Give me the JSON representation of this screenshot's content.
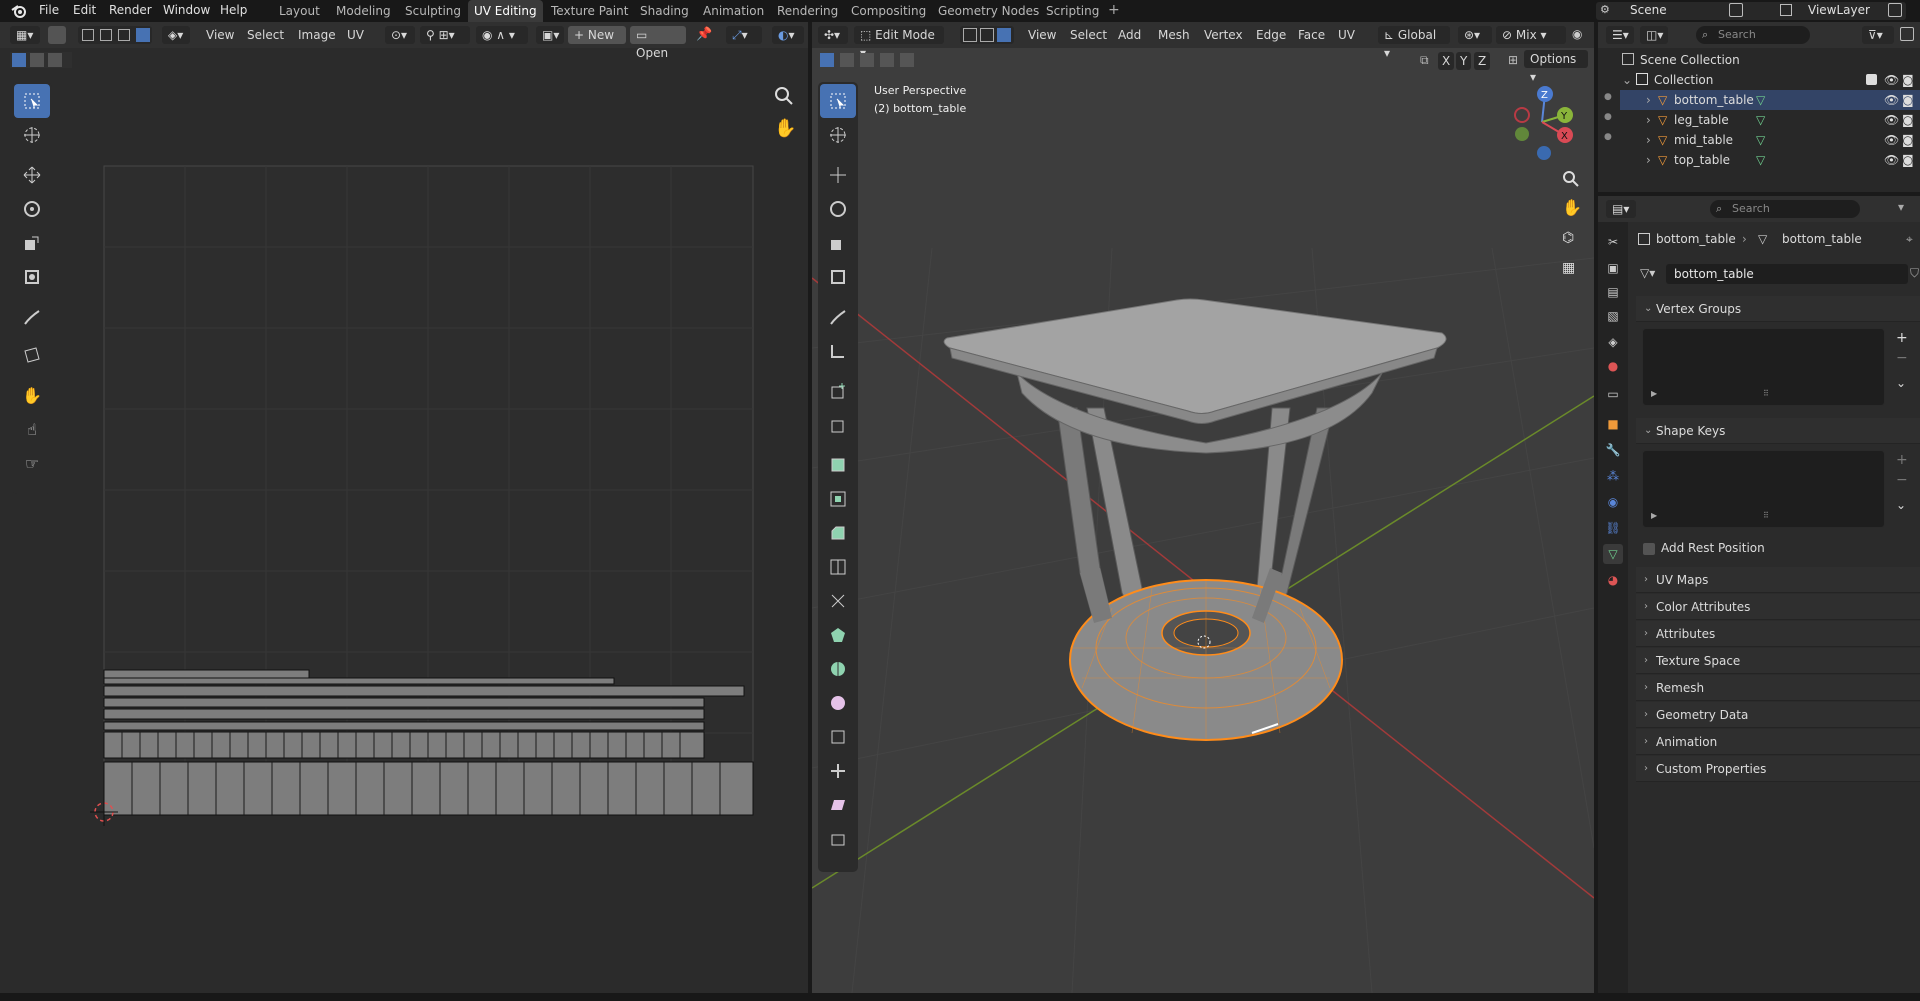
{
  "topbar": {
    "menus": [
      "File",
      "Edit",
      "Render",
      "Window",
      "Help"
    ],
    "workspaces": [
      "Layout",
      "Modeling",
      "Sculpting",
      "UV Editing",
      "Texture Paint",
      "Shading",
      "Animation",
      "Rendering",
      "Compositing",
      "Geometry Nodes",
      "Scripting"
    ],
    "active_workspace": "UV Editing",
    "scene": "Scene",
    "view_layer": "ViewLayer"
  },
  "uv_editor": {
    "menus": [
      "View",
      "Select",
      "Image",
      "UV"
    ],
    "new_label": "New",
    "open_label": "Open"
  },
  "viewport": {
    "mode": "Edit Mode",
    "menus": [
      "View",
      "Select",
      "Add",
      "Mesh",
      "Vertex",
      "Edge",
      "Face",
      "UV"
    ],
    "transform_orientation": "Global",
    "snap_mode": "Mix",
    "axis_x": "X",
    "axis_y": "Y",
    "axis_z": "Z",
    "options_label": "Options",
    "overlay_view": "User Perspective",
    "overlay_object": "(2) bottom_table",
    "colors": {
      "selection": "#ff8c1a",
      "x_axis": "#a23a3a",
      "y_axis": "#6a8a2a",
      "active_tool": "#4772b3"
    }
  },
  "outliner": {
    "search_placeholder": "Search",
    "scene_collection": "Scene Collection",
    "collection": "Collection",
    "objects": [
      "bottom_table",
      "leg_table",
      "mid_table",
      "top_table"
    ]
  },
  "properties": {
    "search_placeholder": "Search",
    "breadcrumb_object": "bottom_table",
    "breadcrumb_data": "bottom_table",
    "mesh_name": "bottom_table",
    "panels": {
      "vertex_groups": "Vertex Groups",
      "shape_keys": "Shape Keys",
      "add_rest_position": "Add Rest Position",
      "uv_maps": "UV Maps",
      "color_attributes": "Color Attributes",
      "attributes": "Attributes",
      "texture_space": "Texture Space",
      "remesh": "Remesh",
      "geometry_data": "Geometry Data",
      "animation": "Animation",
      "custom_properties": "Custom Properties"
    }
  }
}
